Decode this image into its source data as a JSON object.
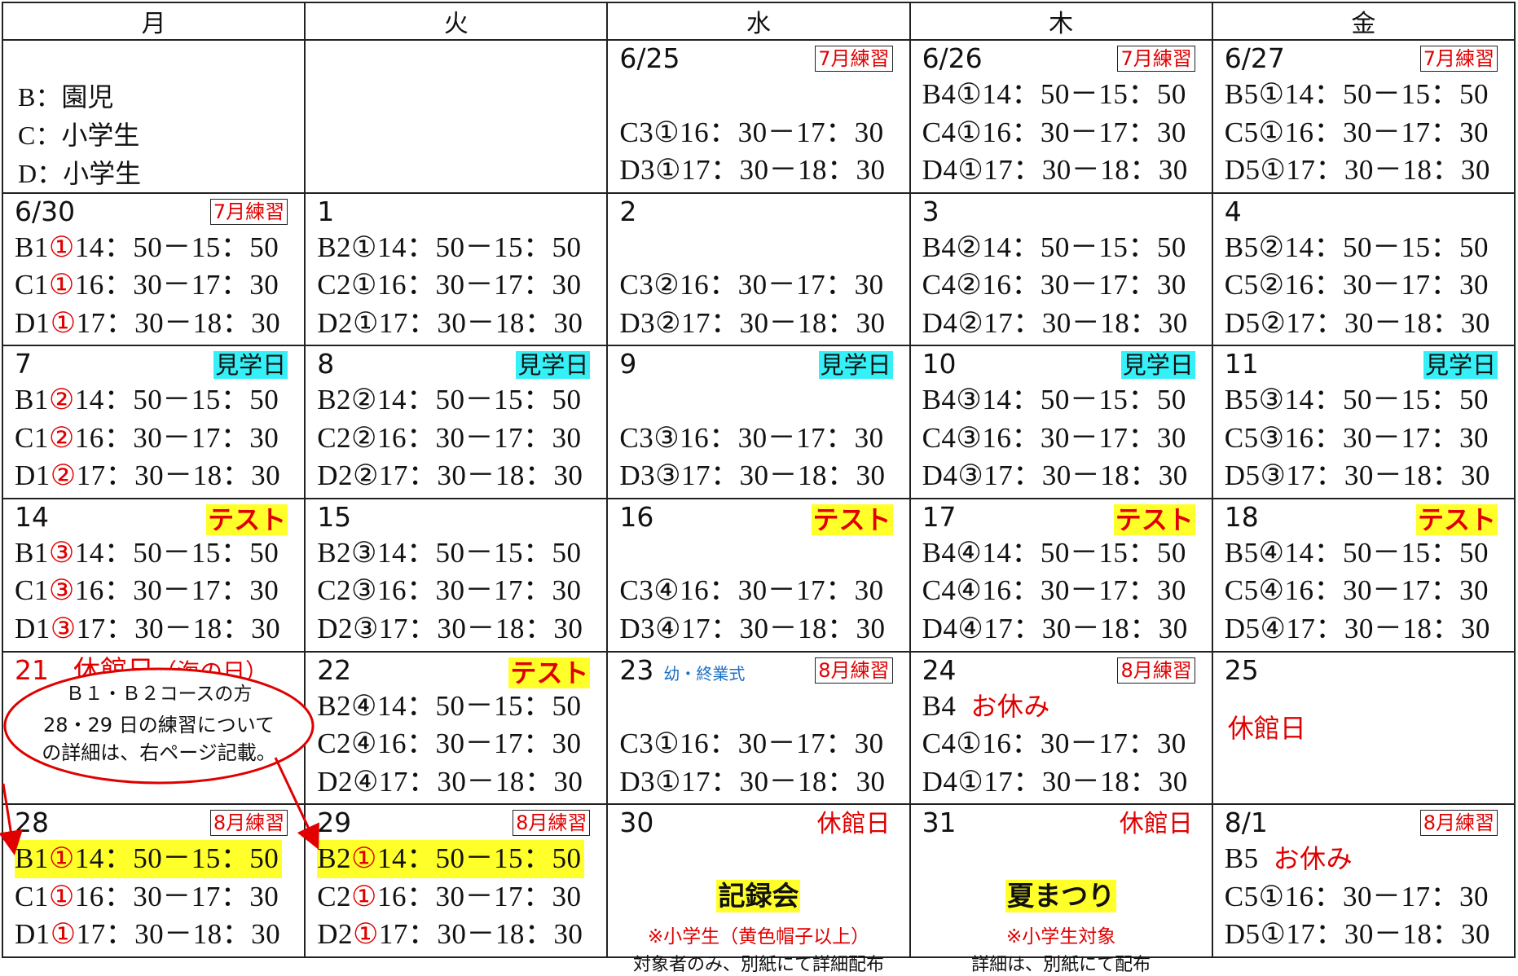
{
  "weekdays": [
    "月",
    "火",
    "水",
    "木",
    "金"
  ],
  "legend": [
    "B：園児",
    "C：小学生",
    "D：小学生"
  ],
  "colors": {
    "red": "#e00000",
    "cyan": "#35f0f6",
    "yellow": "#ffff2a",
    "blue": "#1a6fc4"
  },
  "weeks": [
    [
      {
        "legend": true
      },
      {
        "empty": true
      },
      {
        "day": "6/25",
        "tag": "7月練習",
        "tag_style": "box",
        "lines": [
          null,
          {
            "code": "C3",
            "n": "①",
            "time": "16：30－17：30"
          },
          {
            "code": "D3",
            "n": "①",
            "time": "17：30－18：30"
          }
        ]
      },
      {
        "day": "6/26",
        "tag": "7月練習",
        "tag_style": "box",
        "lines": [
          {
            "code": "B4",
            "n": "①",
            "time": "14：50－15：50"
          },
          {
            "code": "C4",
            "n": "①",
            "time": "16：30－17：30"
          },
          {
            "code": "D4",
            "n": "①",
            "time": "17：30－18：30"
          }
        ]
      },
      {
        "day": "6/27",
        "tag": "7月練習",
        "tag_style": "box",
        "lines": [
          {
            "code": "B5",
            "n": "①",
            "time": "14：50－15：50"
          },
          {
            "code": "C5",
            "n": "①",
            "time": "16：30－17：30"
          },
          {
            "code": "D5",
            "n": "①",
            "time": "17：30－18：30"
          }
        ]
      }
    ],
    [
      {
        "day": "6/30",
        "tag": "7月練習",
        "tag_style": "box",
        "lines": [
          {
            "code": "B1",
            "n": "①",
            "red": true,
            "time": "14：50－15：50"
          },
          {
            "code": "C1",
            "n": "①",
            "red": true,
            "time": "16：30－17：30"
          },
          {
            "code": "D1",
            "n": "①",
            "red": true,
            "time": "17：30－18：30"
          }
        ]
      },
      {
        "day": "1",
        "lines": [
          {
            "code": "B2",
            "n": "①",
            "time": "14：50－15：50"
          },
          {
            "code": "C2",
            "n": "①",
            "time": "16：30－17：30"
          },
          {
            "code": "D2",
            "n": "①",
            "time": "17：30－18：30"
          }
        ]
      },
      {
        "day": "2",
        "lines": [
          null,
          {
            "code": "C3",
            "n": "②",
            "time": "16：30－17：30"
          },
          {
            "code": "D3",
            "n": "②",
            "time": "17：30－18：30"
          }
        ]
      },
      {
        "day": "3",
        "lines": [
          {
            "code": "B4",
            "n": "②",
            "time": "14：50－15：50"
          },
          {
            "code": "C4",
            "n": "②",
            "time": "16：30－17：30"
          },
          {
            "code": "D4",
            "n": "②",
            "time": "17：30－18：30"
          }
        ]
      },
      {
        "day": "4",
        "lines": [
          {
            "code": "B5",
            "n": "②",
            "time": "14：50－15：50"
          },
          {
            "code": "C5",
            "n": "②",
            "time": "16：30－17：30"
          },
          {
            "code": "D5",
            "n": "②",
            "time": "17：30－18：30"
          }
        ]
      }
    ],
    [
      {
        "day": "7",
        "tag": "見学日",
        "tag_style": "cyan",
        "lines": [
          {
            "code": "B1",
            "n": "②",
            "red": true,
            "time": "14：50－15：50"
          },
          {
            "code": "C1",
            "n": "②",
            "red": true,
            "time": "16：30－17：30"
          },
          {
            "code": "D1",
            "n": "②",
            "red": true,
            "time": "17：30－18：30"
          }
        ]
      },
      {
        "day": "8",
        "tag": "見学日",
        "tag_style": "cyan",
        "lines": [
          {
            "code": "B2",
            "n": "②",
            "time": "14：50－15：50"
          },
          {
            "code": "C2",
            "n": "②",
            "time": "16：30－17：30"
          },
          {
            "code": "D2",
            "n": "②",
            "time": "17：30－18：30"
          }
        ]
      },
      {
        "day": "9",
        "tag": "見学日",
        "tag_style": "cyan",
        "lines": [
          null,
          {
            "code": "C3",
            "n": "③",
            "time": "16：30－17：30"
          },
          {
            "code": "D3",
            "n": "③",
            "time": "17：30－18：30"
          }
        ]
      },
      {
        "day": "10",
        "tag": "見学日",
        "tag_style": "cyan",
        "lines": [
          {
            "code": "B4",
            "n": "③",
            "time": "14：50－15：50"
          },
          {
            "code": "C4",
            "n": "③",
            "time": "16：30－17：30"
          },
          {
            "code": "D4",
            "n": "③",
            "time": "17：30－18：30"
          }
        ]
      },
      {
        "day": "11",
        "tag": "見学日",
        "tag_style": "cyan",
        "lines": [
          {
            "code": "B5",
            "n": "③",
            "time": "14：50－15：50"
          },
          {
            "code": "C5",
            "n": "③",
            "time": "16：30－17：30"
          },
          {
            "code": "D5",
            "n": "③",
            "time": "17：30－18：30"
          }
        ]
      }
    ],
    [
      {
        "day": "14",
        "tag": "テスト",
        "tag_style": "yellow",
        "lines": [
          {
            "code": "B1",
            "n": "③",
            "red": true,
            "time": "14：50－15：50"
          },
          {
            "code": "C1",
            "n": "③",
            "red": true,
            "time": "16：30－17：30"
          },
          {
            "code": "D1",
            "n": "③",
            "red": true,
            "time": "17：30－18：30"
          }
        ]
      },
      {
        "day": "15",
        "lines": [
          {
            "code": "B2",
            "n": "③",
            "time": "14：50－15：50"
          },
          {
            "code": "C2",
            "n": "③",
            "time": "16：30－17：30"
          },
          {
            "code": "D2",
            "n": "③",
            "time": "17：30－18：30"
          }
        ]
      },
      {
        "day": "16",
        "tag": "テスト",
        "tag_style": "yellow",
        "lines": [
          null,
          {
            "code": "C3",
            "n": "④",
            "time": "16：30－17：30"
          },
          {
            "code": "D3",
            "n": "④",
            "time": "17：30－18：30"
          }
        ]
      },
      {
        "day": "17",
        "tag": "テスト",
        "tag_style": "yellow",
        "lines": [
          {
            "code": "B4",
            "n": "④",
            "time": "14：50－15：50"
          },
          {
            "code": "C4",
            "n": "④",
            "time": "16：30－17：30"
          },
          {
            "code": "D4",
            "n": "④",
            "time": "17：30－18：30"
          }
        ]
      },
      {
        "day": "18",
        "tag": "テスト",
        "tag_style": "yellow",
        "lines": [
          {
            "code": "B5",
            "n": "④",
            "time": "14：50－15：50"
          },
          {
            "code": "C5",
            "n": "④",
            "time": "16：30－17：30"
          },
          {
            "code": "D5",
            "n": "④",
            "time": "17：30－18：30"
          }
        ]
      }
    ],
    [
      {
        "day": "21",
        "holiday": "休館日",
        "holiday_note": "（海の日）",
        "callout": true
      },
      {
        "day": "22",
        "tag": "テスト",
        "tag_style": "yellow",
        "lines": [
          {
            "code": "B2",
            "n": "④",
            "time": "14：50－15：50"
          },
          {
            "code": "C2",
            "n": "④",
            "time": "16：30－17：30"
          },
          {
            "code": "D2",
            "n": "④",
            "time": "17：30－18：30"
          }
        ]
      },
      {
        "day": "23",
        "sub": "幼・終業式",
        "tag": "8月練習",
        "tag_style": "box",
        "lines": [
          null,
          {
            "code": "C3",
            "n": "①",
            "time": "16：30－17：30"
          },
          {
            "code": "D3",
            "n": "①",
            "time": "17：30－18：30"
          }
        ]
      },
      {
        "day": "24",
        "tag": "8月練習",
        "tag_style": "box",
        "lines": [
          {
            "code": "B4",
            "rest": "お休み"
          },
          {
            "code": "C4",
            "n": "①",
            "time": "16：30－17：30"
          },
          {
            "code": "D4",
            "n": "①",
            "time": "17：30－18：30"
          }
        ]
      },
      {
        "day": "25",
        "closed": "休館日"
      }
    ],
    [
      {
        "day": "28",
        "tag": "8月練習",
        "tag_style": "box",
        "first_hl": true,
        "lines": [
          {
            "code": "B1",
            "n": "①",
            "red": true,
            "time": "14：50－15：50"
          },
          {
            "code": "C1",
            "n": "①",
            "red": true,
            "time": "16：30－17：30"
          },
          {
            "code": "D1",
            "n": "①",
            "red": true,
            "time": "17：30－18：30"
          }
        ]
      },
      {
        "day": "29",
        "tag": "8月練習",
        "tag_style": "box",
        "first_hl": true,
        "lines": [
          {
            "code": "B2",
            "n": "①",
            "red": true,
            "time": "14：50－15：50"
          },
          {
            "code": "C2",
            "n": "①",
            "red": true,
            "time": "16：30－17：30"
          },
          {
            "code": "D2",
            "n": "①",
            "red": true,
            "time": "17：30－18：30"
          }
        ]
      },
      {
        "day": "30",
        "tag": "休館日",
        "tag_style": "plain",
        "event": {
          "title": "記録会",
          "note1": "※小学生（黄色帽子以上）",
          "note2": "対象者のみ、別紙にて詳細配布"
        }
      },
      {
        "day": "31",
        "tag": "休館日",
        "tag_style": "plain",
        "event": {
          "title": "夏まつり",
          "note1": "※小学生対象",
          "note2": "詳細は、別紙にて配布"
        }
      },
      {
        "day": "8/1",
        "tag": "8月練習",
        "tag_style": "box",
        "lines": [
          {
            "code": "B5",
            "rest": "お休み"
          },
          {
            "code": "C5",
            "n": "①",
            "time": "16：30－17：30"
          },
          {
            "code": "D5",
            "n": "①",
            "time": "17：30－18：30"
          }
        ]
      }
    ]
  ],
  "callout": {
    "line1": "Ｂ１・Ｂ２コースの方",
    "line2": "28・29 日の練習について",
    "line3": "の詳細は、右ページ記載。"
  }
}
